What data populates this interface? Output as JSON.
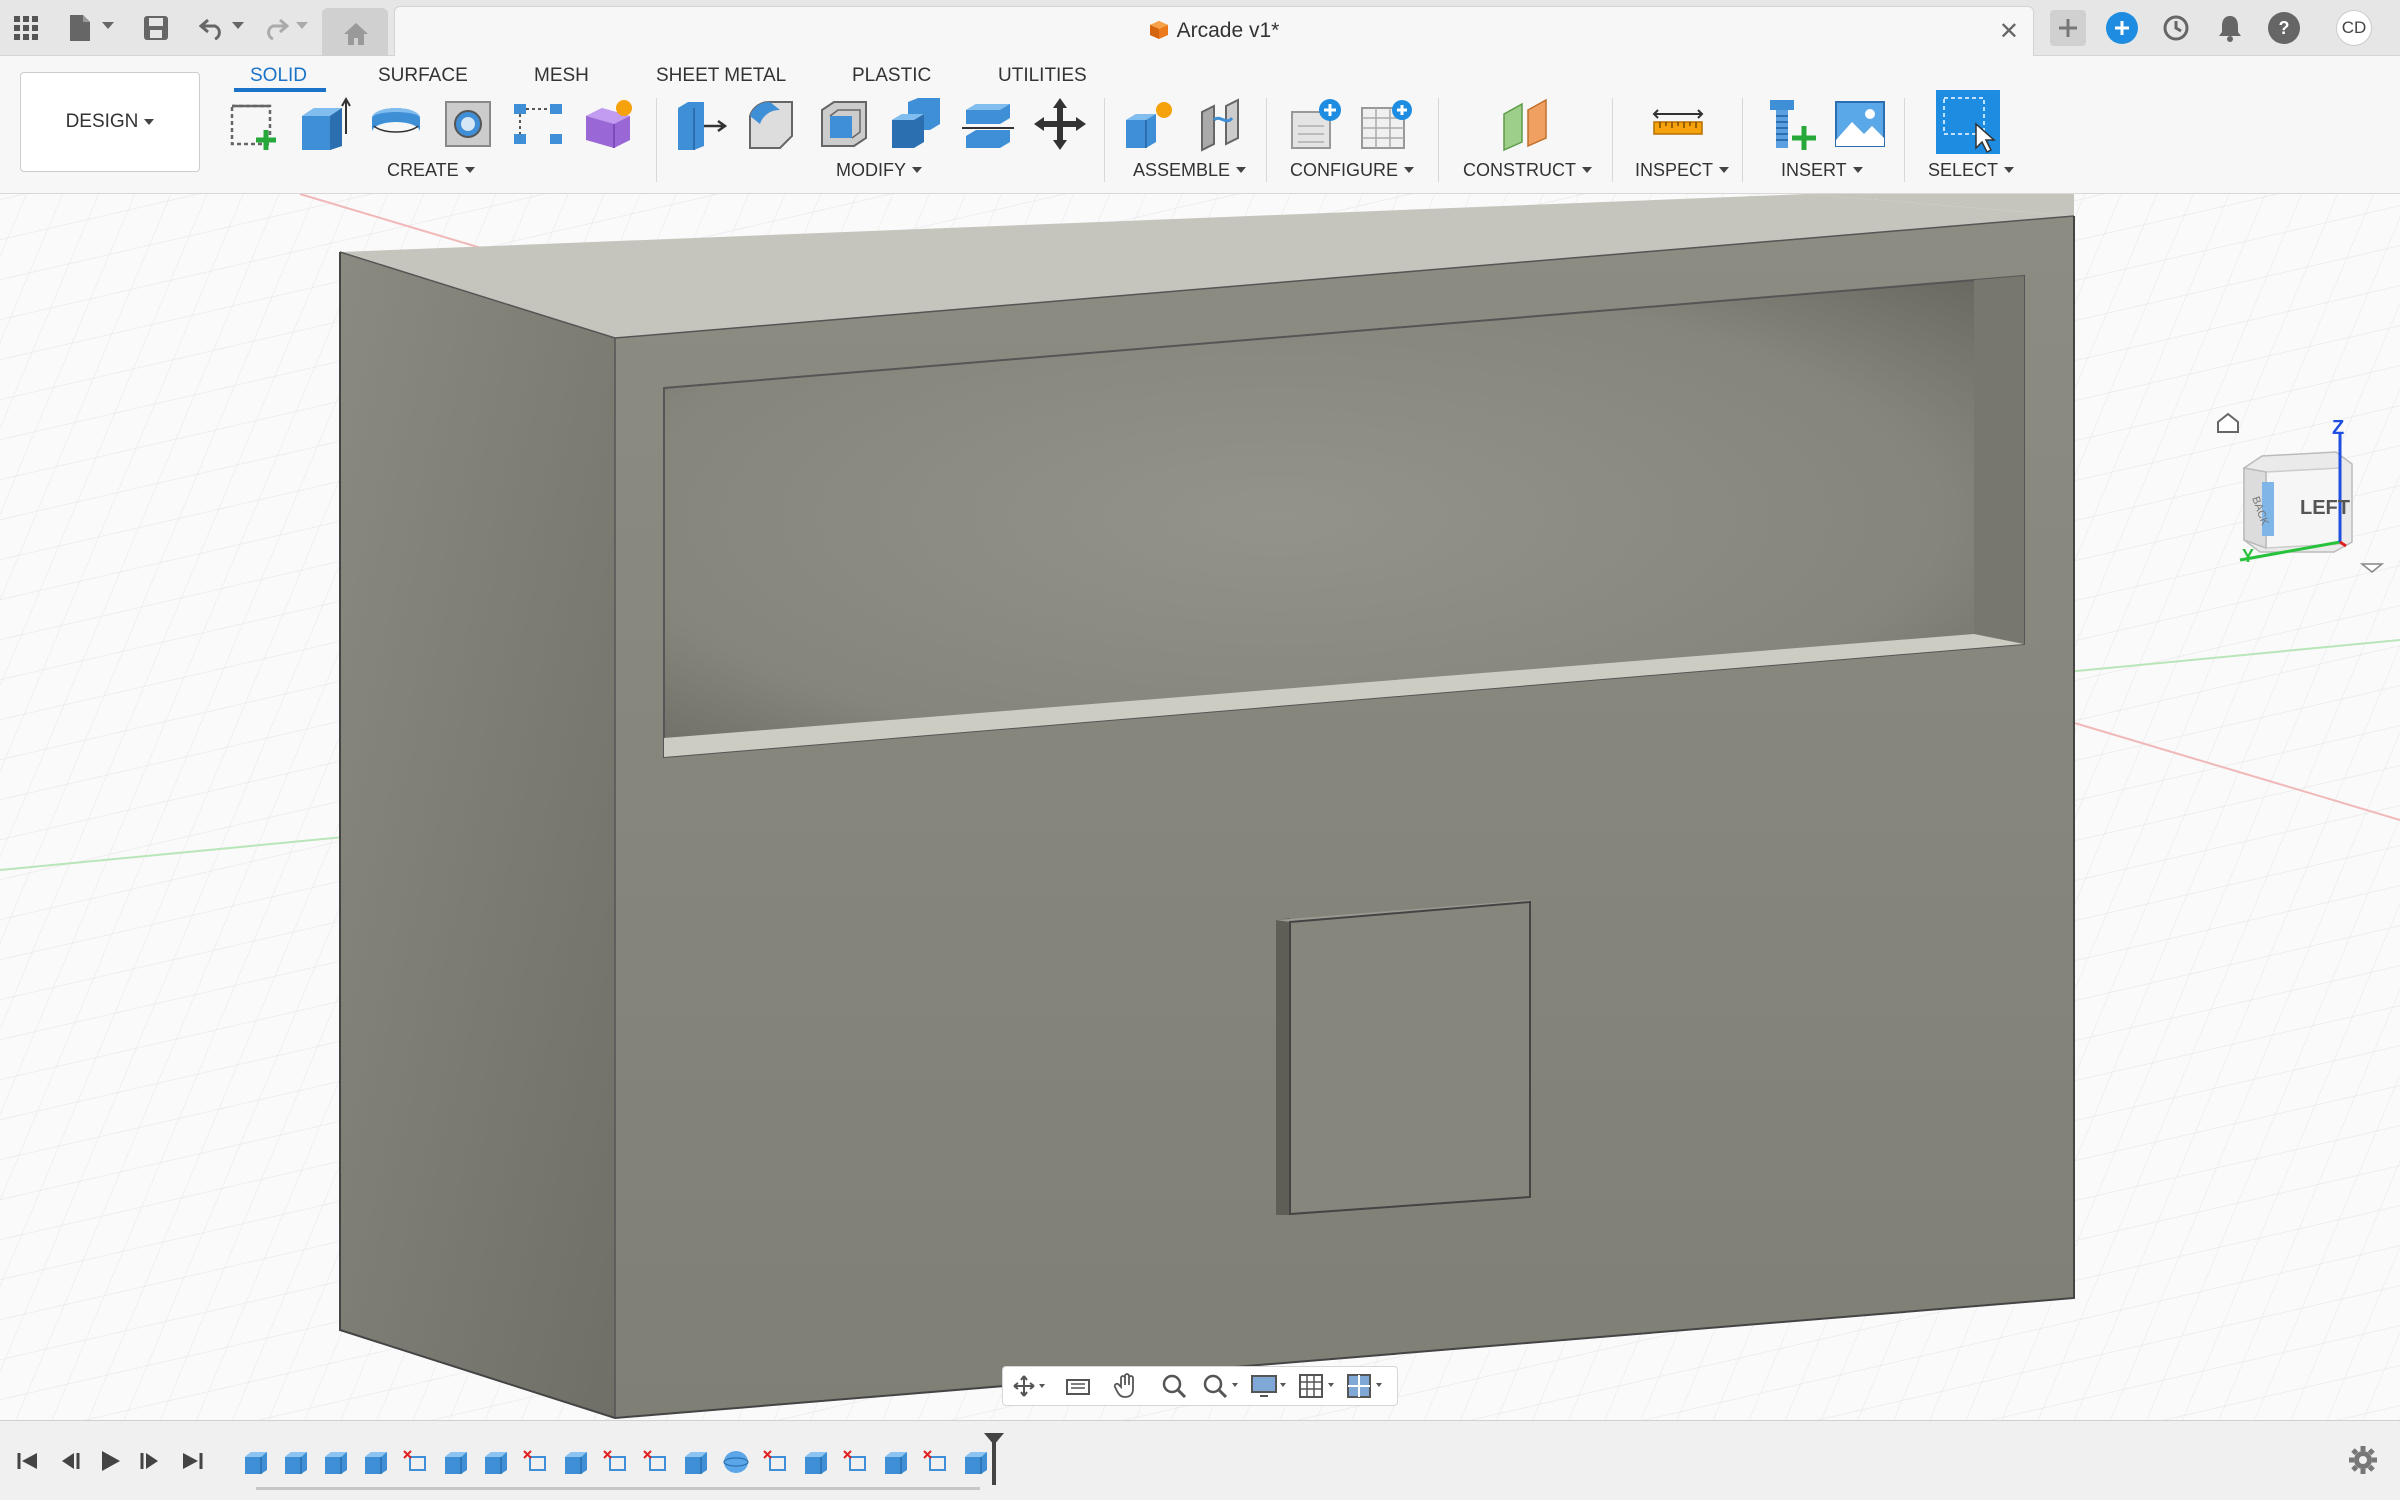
{
  "titlebar": {
    "document_title": "Arcade v1*",
    "close_glyph": "✕",
    "user_initials": "CD",
    "icons": [
      "apps-grid-icon",
      "file-icon",
      "save-icon",
      "undo-icon",
      "redo-icon",
      "home-icon",
      "new-tab-icon",
      "extensions-icon",
      "job-status-icon",
      "notifications-icon",
      "help-icon"
    ]
  },
  "toolbar": {
    "workspace": "DESIGN",
    "tabs": [
      "SOLID",
      "SURFACE",
      "MESH",
      "SHEET METAL",
      "PLASTIC",
      "UTILITIES"
    ],
    "active_tab": "SOLID",
    "groups": {
      "create": "CREATE",
      "modify": "MODIFY",
      "assemble": "ASSEMBLE",
      "configure": "CONFIGURE",
      "construct": "CONSTRUCT",
      "inspect": "INSPECT",
      "insert": "INSERT",
      "select": "SELECT"
    },
    "accent_color": "#1a73c8"
  },
  "viewcube": {
    "face_label": "LEFT",
    "side_label": "BACK",
    "axis_z": "Z",
    "axis_y": "Y"
  },
  "navbar": {
    "icons": [
      "orbit-icon",
      "look-at-icon",
      "pan-icon",
      "zoom-icon",
      "fit-icon",
      "display-settings-icon",
      "grid-settings-icon",
      "viewports-icon"
    ]
  },
  "timeline": {
    "controls": [
      "go-to-start",
      "step-back",
      "play",
      "step-forward",
      "go-to-end"
    ],
    "feature_types": [
      "extrude",
      "extrude",
      "extrude",
      "extrude",
      "sketch",
      "extrude",
      "extrude",
      "sketch",
      "extrude",
      "sketch",
      "sketch",
      "extrude",
      "sphere",
      "sketch",
      "extrude",
      "sketch",
      "extrude",
      "sketch",
      "extrude"
    ]
  }
}
